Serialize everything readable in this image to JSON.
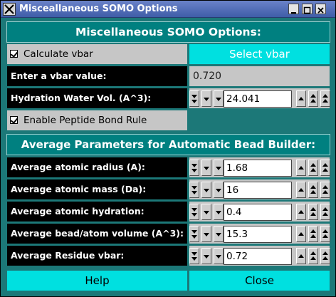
{
  "window": {
    "title": "Misceallaneous SOMO Options",
    "controls": [
      "minimize-icon",
      "maximize-icon",
      "close-icon"
    ]
  },
  "header": {
    "title": "Miscellaneous SOMO Options:"
  },
  "vbar": {
    "calculate_label": "Calculate vbar",
    "calculate_checked": true,
    "select_button": "Select vbar",
    "enter_label": "Enter a vbar value:",
    "value": "0.720"
  },
  "hydration": {
    "label": "Hydration Water Vol. (A^3):",
    "value": "24.041"
  },
  "peptide": {
    "label": "Enable Peptide Bond Rule",
    "checked": true
  },
  "avg_header": {
    "title": "Average Parameters for Automatic Bead Builder:"
  },
  "avg_rows": [
    {
      "label": "Average atomic radius (A):",
      "value": "1.68"
    },
    {
      "label": "Average atomic mass (Da):",
      "value": "16"
    },
    {
      "label": "Average atomic hydration:",
      "value": "0.4"
    },
    {
      "label": "Average bead/atom volume (A^3):",
      "value": "15.3"
    },
    {
      "label": "Average Residue vbar:",
      "value": "0.72"
    }
  ],
  "footer": {
    "help": "Help",
    "close": "Close"
  },
  "colors": {
    "background": "#1c7878",
    "header": "#008080",
    "button": "#00e0e0",
    "label": "#000000",
    "field": "#c6c6c6"
  }
}
